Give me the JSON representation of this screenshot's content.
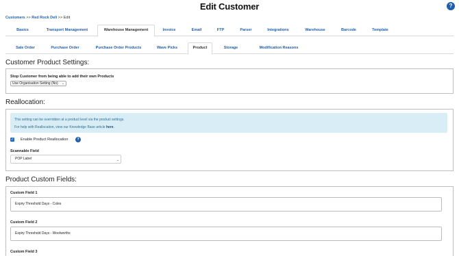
{
  "page": {
    "title": "Edit Customer",
    "help": "?"
  },
  "breadcrumb": {
    "link1": "Customers",
    "sep1": ">>",
    "link2": "Red Rock Deli",
    "sep2": ">>",
    "current": "Edit"
  },
  "tabs_primary": [
    {
      "label": "Basics"
    },
    {
      "label": "Transport Management"
    },
    {
      "label": "Warehouse Management"
    },
    {
      "label": "Invoice"
    },
    {
      "label": "Email"
    },
    {
      "label": "FTP"
    },
    {
      "label": "Parser"
    },
    {
      "label": "Integrations"
    },
    {
      "label": "Warehouse"
    },
    {
      "label": "Barcode"
    },
    {
      "label": "Template"
    }
  ],
  "tabs_secondary": [
    {
      "label": "Sale Order"
    },
    {
      "label": "Purchase Order"
    },
    {
      "label": "Purchase Order Products"
    },
    {
      "label": "Wave Picks"
    },
    {
      "label": "Product"
    },
    {
      "label": "Storage"
    },
    {
      "label": "Modification Reasons"
    }
  ],
  "product_settings": {
    "heading": "Customer Product Settings:",
    "stop_label": "Stop Customer from being able to add their own Products",
    "stop_value": "Use Organisation Setting (No)"
  },
  "reallocation": {
    "heading": "Reallocation:",
    "info_line1": "This setting can be overridden at a product level via the product settings.",
    "info_line2_prefix": "For help with Reallocation, view our Knowledge Base article",
    "info_line2_link": "here",
    "info_line2_suffix": ".",
    "enable_label": "Enable Product Reallocation",
    "enable_checked": true,
    "scannable_label": "Scannable Field",
    "scannable_value": "POP Label"
  },
  "custom_fields": {
    "heading": "Product Custom Fields:",
    "fields": [
      {
        "label": "Custom Field 1",
        "value": "Expiry Threshold Days - Coles"
      },
      {
        "label": "Custom Field 2",
        "value": "Expiry Threshold Days - Woolworths"
      },
      {
        "label": "Custom Field 3",
        "value": ""
      }
    ]
  },
  "icons": {
    "checkmark": "✓",
    "caret": "⌄"
  },
  "colors": {
    "link": "#1f5fae",
    "info_bg": "#d9edf7",
    "checkbox": "#1f6fd1"
  }
}
